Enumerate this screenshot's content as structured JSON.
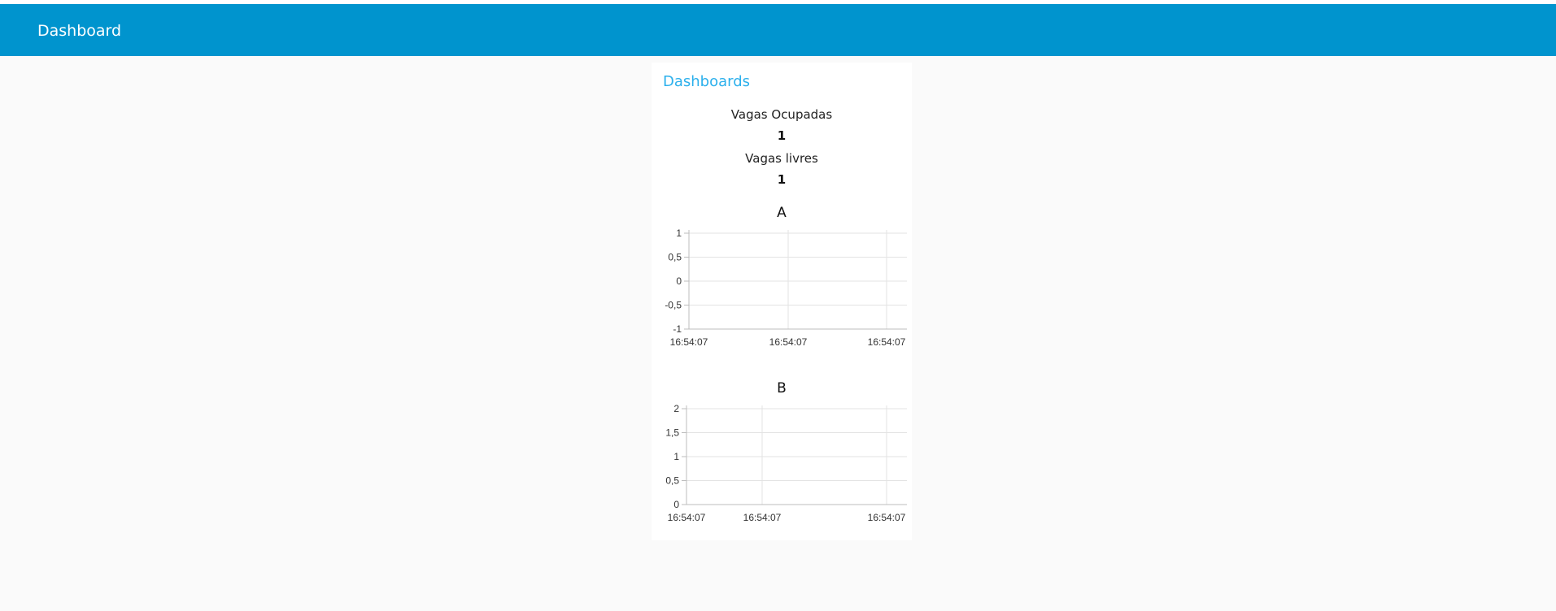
{
  "header": {
    "title": "Dashboard",
    "background_color": "#0094ce"
  },
  "card": {
    "title": "Dashboards",
    "title_color": "#2cb0ec",
    "stats": [
      {
        "label": "Vagas Ocupadas",
        "value": "1"
      },
      {
        "label": "Vagas livres",
        "value": "1"
      }
    ]
  },
  "chart_data": [
    {
      "type": "line",
      "title": "A",
      "ylim": [
        -1,
        1
      ],
      "y_ticks": [
        "1",
        "0,5",
        "0",
        "-0,5",
        "-1"
      ],
      "x_ticks": [
        "16:54:07",
        "16:54:07",
        "16:54:07"
      ],
      "series": [],
      "grid": true
    },
    {
      "type": "line",
      "title": "B",
      "ylim": [
        0,
        2
      ],
      "y_ticks": [
        "2",
        "1,5",
        "1",
        "0,5",
        "0"
      ],
      "x_ticks": [
        "16:54:07",
        "16:54:07",
        "16:54:07"
      ],
      "series": [],
      "grid": true
    }
  ]
}
